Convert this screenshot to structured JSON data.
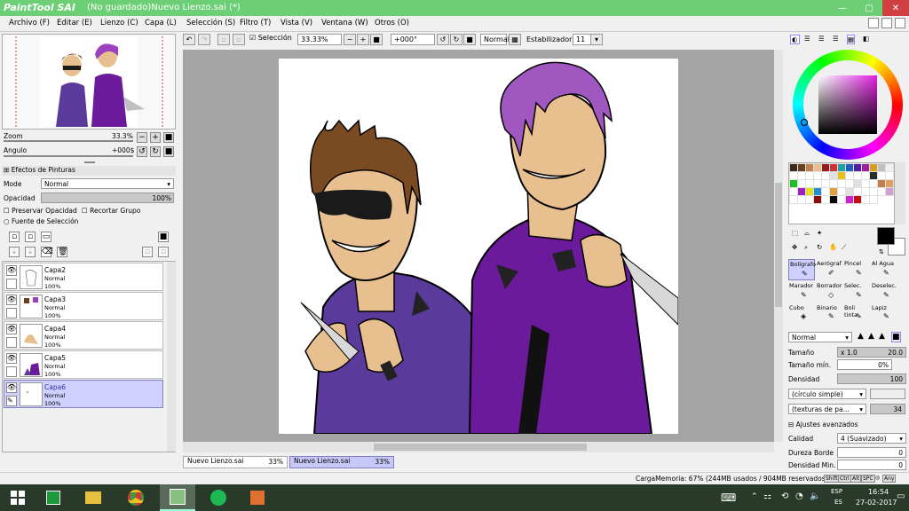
{
  "title": {
    "logo": "PaintTool SAI",
    "text": "(No guardado)Nuevo Lienzo.sai (*)"
  },
  "menu": [
    "Archivo (F)",
    "Editar (E)",
    "Lienzo (C)",
    "Capa (L)",
    "Selección (S)",
    "Filtro (T)",
    "Vista (V)",
    "Ventana (W)",
    "Otros (O)"
  ],
  "nav": {
    "zoom_label": "Zoom",
    "zoom_value": "33.3%",
    "angle_label": "Angulo",
    "angle_value": "+000$"
  },
  "effects": {
    "header": "Efectos de Pinturas",
    "mode_label": "Mode",
    "mode_value": "Normal",
    "opacity_label": "Opacidad",
    "opacity_value": "100%",
    "preserve": "Preservar Opacidad",
    "clip": "Recortar Grupo",
    "selsource": "Fuente de Selección"
  },
  "layers": [
    {
      "name": "Capa2",
      "mode": "Normal",
      "opacity": "100%"
    },
    {
      "name": "Capa3",
      "mode": "Normal",
      "opacity": "100%"
    },
    {
      "name": "Capa4",
      "mode": "Normal",
      "opacity": "100%"
    },
    {
      "name": "Capa5",
      "mode": "Normal",
      "opacity": "100%"
    },
    {
      "name": "Capa6",
      "mode": "Normal",
      "opacity": "100%"
    }
  ],
  "toolbar": {
    "seleccion": "Selección",
    "zoom": "33.33%",
    "angle": "+000°",
    "mode": "Normal",
    "stab_label": "Estabilizador",
    "stab": "11"
  },
  "tabs": [
    {
      "name": "Nuevo Lienzo.sai",
      "pct": "33%"
    },
    {
      "name": "Nuevo Lienzo.sai",
      "pct": "33%"
    }
  ],
  "status": "CargaMemoria: 67% (244MB usados / 904MB reservados)",
  "keys": [
    "Shift",
    "Ctrl",
    "Alt",
    "SPC",
    "Any"
  ],
  "tools": [
    "Bolígrafo",
    "Aerógraf",
    "Pincel",
    "Al Agua",
    "Marador",
    "Borrador",
    "Selec.",
    "Deselec.",
    "Cubo",
    "Binario",
    "Boli tinta",
    "Lapiz"
  ],
  "brush": {
    "mode": "Normal",
    "size_label": "Tamaño",
    "size_mult": "x 1.0",
    "size": "20.0",
    "minsize_label": "Tamaño mín.",
    "minsize": "0%",
    "density_label": "Densidad",
    "density": "100",
    "shape": "(círculo simple)",
    "texture": "(texturas de pa...",
    "texture_val": "34",
    "adv": "Ajustes avanzados",
    "quality_label": "Calidad",
    "quality": "4 (Suavizado)",
    "hardness_label": "Dureza Borde",
    "hardness": "0",
    "mindens_label": "Densidad Min.",
    "mindens": "0"
  },
  "swatches": [
    "#3a2a1e",
    "#6a4020",
    "#c08050",
    "#e8c090",
    "#8a2020",
    "#d03030",
    "#20a0a0",
    "#2060c0",
    "#5020a0",
    "#a020a0",
    "#d0a020",
    "#c0c0c0",
    "#f0f0f0",
    "#ffffff",
    "#ffffff",
    "#ffffff",
    "#ffffff",
    "#ffffff",
    "#e0e0e0",
    "#e8c020",
    "#ffffff",
    "#ffffff",
    "#ffffff",
    "#2a2a2a",
    "#ffffff",
    "#ffffff",
    "#20c020",
    "#ffffff",
    "#ffffff",
    "#ffffff",
    "#ffffff",
    "#ffffff",
    "#ffffff",
    "#ffffff",
    "#e0e0e0",
    "#ffffff",
    "#ffffff",
    "#c08050",
    "#e0a060",
    "#ffffff",
    "#a020c0",
    "#e0e020",
    "#2090d0",
    "#ffffff",
    "#e0a040",
    "#ffffff",
    "#e0e0e0",
    "#ffffff",
    "#ffffff",
    "#ffffff",
    "#ffffff",
    "#d0a0d0",
    "#ffffff",
    "#ffffff",
    "#ffffff",
    "#8a1010",
    "#ffffff",
    "#0a0a0a",
    "#ffffff",
    "#d020d0",
    "#c01010",
    "#ffffff",
    "#ffffff"
  ],
  "clock": {
    "time": "16:54",
    "date": "27-02-2017",
    "lang1": "ESP",
    "lang2": "ES"
  }
}
